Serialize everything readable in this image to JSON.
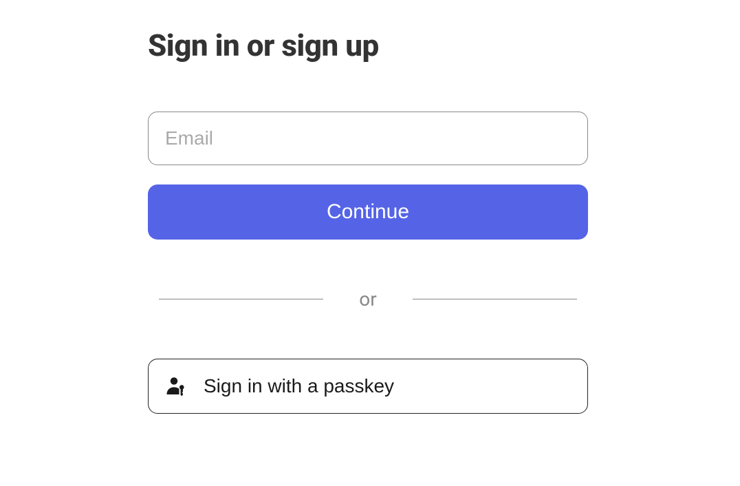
{
  "title": "Sign in or sign up",
  "emailPlaceholder": "Email",
  "continueLabel": "Continue",
  "dividerText": "or",
  "passkeyLabel": "Sign in with a passkey"
}
